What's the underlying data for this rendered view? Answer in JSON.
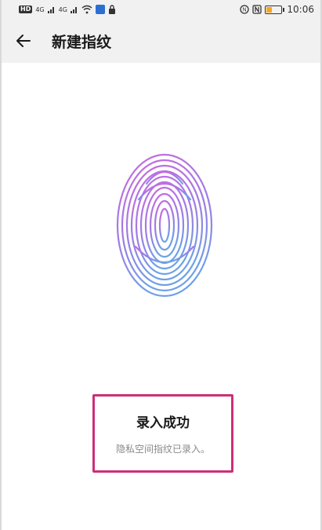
{
  "status_bar": {
    "left": {
      "hd": "HD",
      "signal1": "4G",
      "signal2": "4G"
    },
    "time": "10:06",
    "battery_level": 0.35
  },
  "header": {
    "title": "新建指纹"
  },
  "result": {
    "title": "录入成功",
    "subtitle": "隐私空间指纹已录入。"
  },
  "colors": {
    "accent_border": "#cc2f78",
    "fingerprint_top": "#c86be0",
    "fingerprint_bottom": "#6ea1e6"
  },
  "icons": {
    "back": "arrow-left-icon",
    "fingerprint": "fingerprint-icon"
  }
}
